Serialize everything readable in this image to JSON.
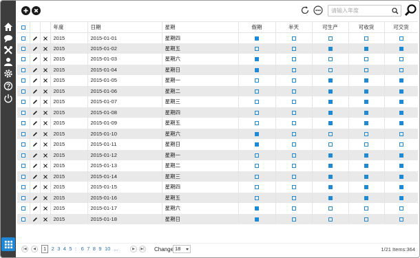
{
  "toolbar": {
    "add_icon": "plus-circle-icon",
    "delete_icon": "times-circle-icon",
    "refresh_icon": "refresh-icon",
    "more_icon": "ellipsis-circle-icon",
    "search_placeholder": "请输入年度",
    "search_value": ""
  },
  "sidebar": {
    "items": [
      "home-icon",
      "comments-icon",
      "tools-icon",
      "user-icon",
      "settings-icon",
      "help-icon",
      "power-icon"
    ],
    "bottom": "grid-icon"
  },
  "table": {
    "columns": [
      "年度",
      "日期",
      "星期",
      "假期",
      "半天",
      "可生产",
      "可收货",
      "可交货"
    ],
    "rows": [
      {
        "year": "2015",
        "date": "2015-01-01",
        "weekday": "星期四",
        "flags": [
          true,
          false,
          false,
          false,
          false
        ]
      },
      {
        "year": "2015",
        "date": "2015-01-02",
        "weekday": "星期五",
        "flags": [
          false,
          false,
          true,
          true,
          true
        ]
      },
      {
        "year": "2015",
        "date": "2015-01-03",
        "weekday": "星期六",
        "flags": [
          true,
          false,
          false,
          false,
          false
        ]
      },
      {
        "year": "2015",
        "date": "2015-01-04",
        "weekday": "星期日",
        "flags": [
          true,
          false,
          false,
          false,
          false
        ]
      },
      {
        "year": "2015",
        "date": "2015-01-05",
        "weekday": "星期一",
        "flags": [
          false,
          false,
          true,
          true,
          true
        ]
      },
      {
        "year": "2015",
        "date": "2015-01-06",
        "weekday": "星期二",
        "flags": [
          false,
          false,
          true,
          true,
          true
        ]
      },
      {
        "year": "2015",
        "date": "2015-01-07",
        "weekday": "星期三",
        "flags": [
          false,
          false,
          true,
          true,
          true
        ]
      },
      {
        "year": "2015",
        "date": "2015-01-08",
        "weekday": "星期四",
        "flags": [
          false,
          false,
          true,
          true,
          true
        ]
      },
      {
        "year": "2015",
        "date": "2015-01-09",
        "weekday": "星期五",
        "flags": [
          false,
          false,
          true,
          true,
          true
        ]
      },
      {
        "year": "2015",
        "date": "2015-01-10",
        "weekday": "星期六",
        "flags": [
          true,
          false,
          false,
          false,
          false
        ]
      },
      {
        "year": "2015",
        "date": "2015-01-11",
        "weekday": "星期日",
        "flags": [
          true,
          false,
          false,
          false,
          false
        ]
      },
      {
        "year": "2015",
        "date": "2015-01-12",
        "weekday": "星期一",
        "flags": [
          false,
          false,
          true,
          true,
          true
        ]
      },
      {
        "year": "2015",
        "date": "2015-01-13",
        "weekday": "星期二",
        "flags": [
          false,
          false,
          true,
          true,
          true
        ]
      },
      {
        "year": "2015",
        "date": "2015-01-14",
        "weekday": "星期三",
        "flags": [
          false,
          false,
          true,
          true,
          true
        ]
      },
      {
        "year": "2015",
        "date": "2015-01-15",
        "weekday": "星期四",
        "flags": [
          false,
          false,
          true,
          true,
          true
        ]
      },
      {
        "year": "2015",
        "date": "2015-01-16",
        "weekday": "星期五",
        "flags": [
          false,
          false,
          true,
          true,
          true
        ]
      },
      {
        "year": "2015",
        "date": "2015-01-17",
        "weekday": "星期六",
        "flags": [
          true,
          false,
          false,
          false,
          false
        ]
      },
      {
        "year": "2015",
        "date": "2015-01-18",
        "weekday": "星期日",
        "flags": [
          true,
          false,
          false,
          false,
          false
        ]
      }
    ]
  },
  "pager": {
    "pages": [
      "1",
      "2",
      "3",
      "4",
      "5",
      ":",
      "6",
      "7",
      "8",
      "9",
      "10",
      "..."
    ],
    "current": "1",
    "change_label": "Change",
    "page_size": "18",
    "info": "1/21 Items:364"
  },
  "colors": {
    "sidebar": "#3d3d3d",
    "accent": "#1e8ad6",
    "row_alt": "#e9e9e9"
  }
}
